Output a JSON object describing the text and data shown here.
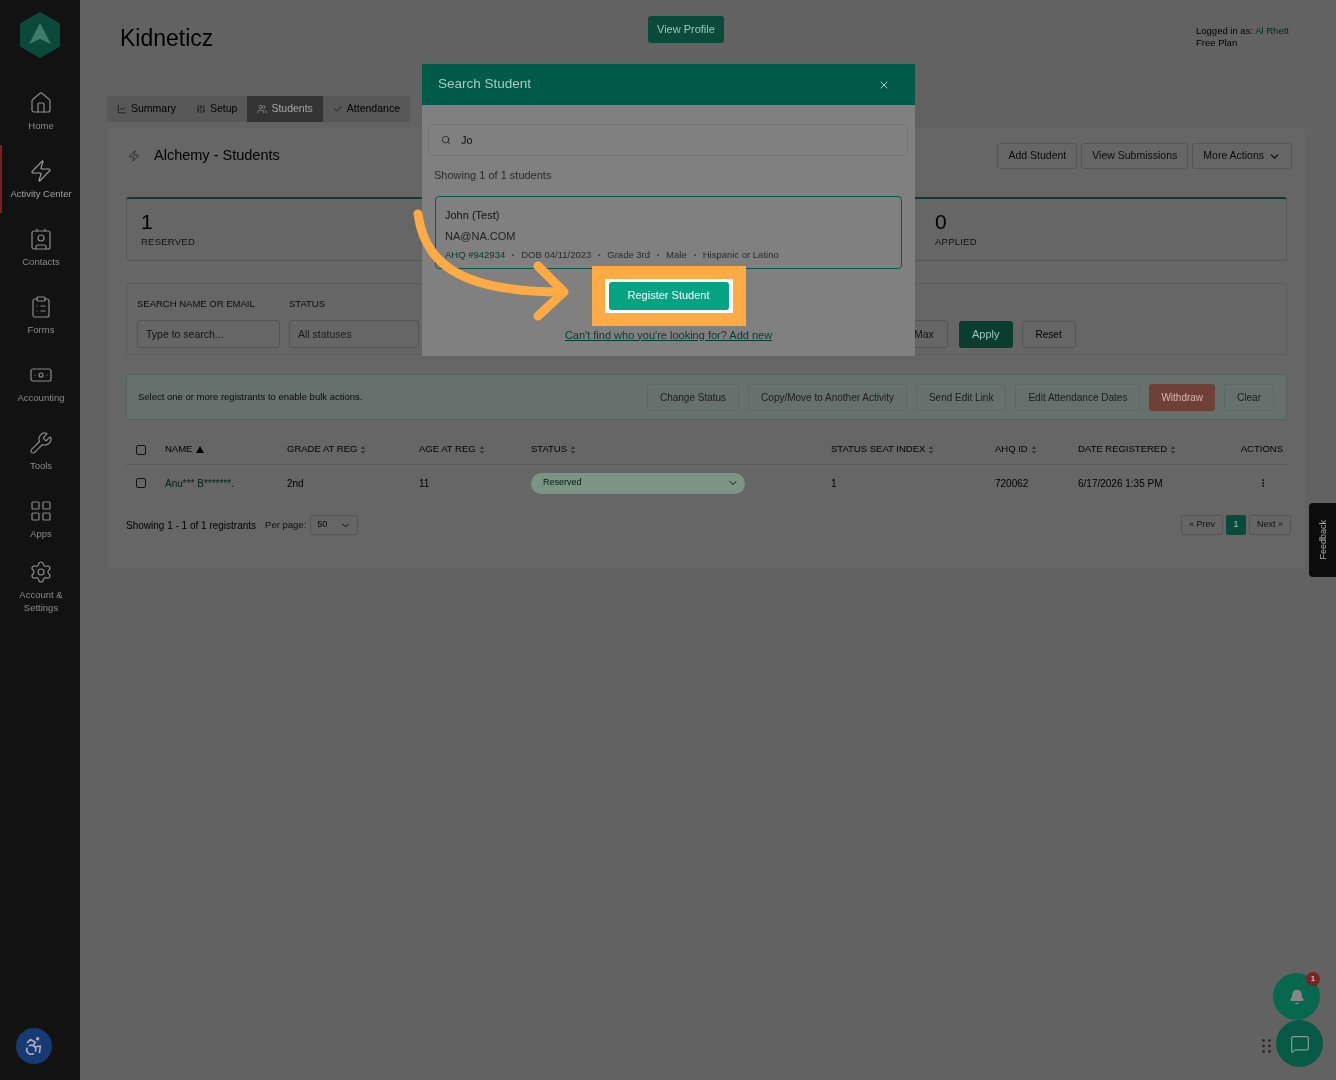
{
  "sidebar": {
    "items": [
      {
        "label": "Home",
        "selected": false
      },
      {
        "label": "Activity Center",
        "selected": true
      },
      {
        "label": "Contacts",
        "selected": false
      },
      {
        "label": "Forms",
        "selected": false
      },
      {
        "label": "Accounting",
        "selected": false
      },
      {
        "label": "Tools",
        "selected": false
      },
      {
        "label": "Apps",
        "selected": false
      },
      {
        "label": "Account & Settings",
        "selected": false
      }
    ]
  },
  "header": {
    "title": "Kidneticz",
    "view_profile": "View Profile",
    "logged_in_label": "Logged in as:",
    "user": "Al Rhett",
    "plan": "Free Plan"
  },
  "tabs": [
    {
      "label": "Summary",
      "selected": false
    },
    {
      "label": "Setup",
      "selected": false
    },
    {
      "label": "Students",
      "selected": true
    },
    {
      "label": "Attendance",
      "selected": false
    }
  ],
  "page": {
    "title": "Alchemy - Students",
    "actions": [
      {
        "label": "Add Student",
        "kind": "plain"
      },
      {
        "label": "View Submissions",
        "kind": "plain"
      },
      {
        "label": "More Actions",
        "kind": "dropdown"
      }
    ]
  },
  "stats": [
    {
      "value": "1",
      "label": "RESERVED"
    },
    {
      "value": "0",
      "label": "APPLIED"
    }
  ],
  "filters": {
    "search_label": "SEARCH NAME OR EMAIL",
    "search_placeholder": "Type to search...",
    "status_label": "STATUS",
    "status_placeholder": "All statuses",
    "max_placeholder": "Max",
    "apply": "Apply",
    "reset": "Reset"
  },
  "bulk": {
    "message": "Select one or more registrants to enable bulk actions.",
    "actions": [
      {
        "label": "Change Status",
        "kind": "default",
        "disabled": true
      },
      {
        "label": "Copy/Move to Another Activity",
        "kind": "default",
        "disabled": true
      },
      {
        "label": "Send Edit Link",
        "kind": "default",
        "disabled": true
      },
      {
        "label": "Edit Attendance Dates",
        "kind": "default",
        "disabled": true
      },
      {
        "label": "Withdraw",
        "kind": "danger",
        "disabled": true
      },
      {
        "label": "Clear",
        "kind": "default",
        "disabled": true
      }
    ]
  },
  "table": {
    "select_all_checked": false,
    "columns": [
      {
        "label": "NAME",
        "sortable": true,
        "sorted_ascending": true
      },
      {
        "label": "GRADE AT REG",
        "sortable": true,
        "sorted_ascending": false
      },
      {
        "label": "AGE AT REG",
        "sortable": true,
        "sorted_ascending": false
      },
      {
        "label": "STATUS",
        "sortable": true,
        "sorted_ascending": false
      },
      {
        "label": "STATUS SEAT INDEX",
        "sortable": true,
        "sorted_ascending": false
      },
      {
        "label": "AHQ ID",
        "sortable": true,
        "sorted_ascending": false
      },
      {
        "label": "DATE REGISTERED",
        "sortable": true,
        "sorted_ascending": false
      },
      {
        "label": "ACTIONS",
        "sortable": false
      }
    ],
    "rows": [
      {
        "checked": false,
        "name": "Anu*** B*******.",
        "grade": "2nd",
        "age": "11",
        "status": "Reserved",
        "seat_index": "1",
        "ahq_id": "720062",
        "date": "6/17/2026 1:35 PM"
      }
    ]
  },
  "footer": {
    "showing": "Showing 1 - 1 of 1 registrants",
    "per_page_label": "Per page:",
    "per_page": "50",
    "prev": "« Prev",
    "pages": [
      {
        "label": "1",
        "selected": true
      }
    ],
    "next": "Next »"
  },
  "feedback": "Feedback",
  "notifications": {
    "badge": "1"
  },
  "modal": {
    "title": "Search Student",
    "search_value": "Jo",
    "result_count": "Showing 1 of 1 students",
    "students": [
      {
        "name": "John (Test)",
        "email": "NA@NA.COM",
        "ahq": "AHQ #942934",
        "details": [
          "DOB 04/11/2023",
          "Grade 3rd",
          "Male",
          "Hispanic or Latino"
        ]
      }
    ],
    "register": "Register Student",
    "add_new_link": "Can't find who you're looking for? Add new"
  }
}
